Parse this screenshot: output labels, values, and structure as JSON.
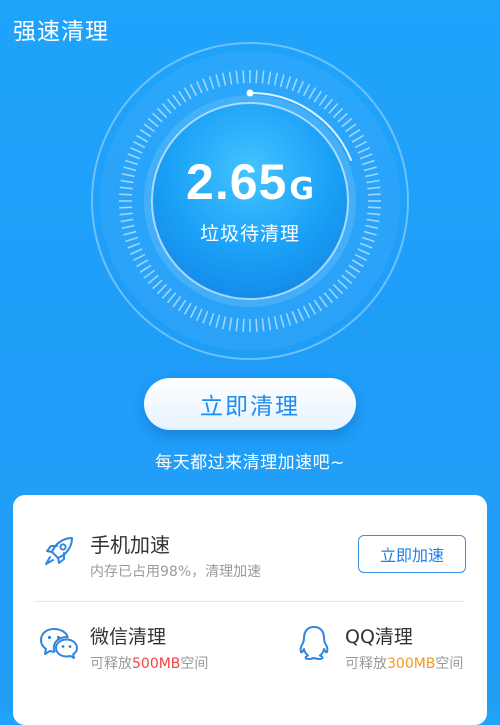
{
  "header": {
    "title": "强速清理"
  },
  "gauge": {
    "value": "2.65",
    "unit": "G",
    "caption": "垃圾待清理"
  },
  "clean_button": {
    "label": "立即清理"
  },
  "tagline": "每天都过来清理加速吧~",
  "phone_speed": {
    "title": "手机加速",
    "subtitle": "内存已占用98%，清理加速",
    "button": "立即加速"
  },
  "wechat_clean": {
    "title": "微信清理",
    "sub_prefix": "可释放",
    "amount": "500MB",
    "sub_suffix": "空间",
    "icon": "wechat-icon",
    "highlight_color": "#f2453d"
  },
  "qq_clean": {
    "title": "QQ清理",
    "sub_prefix": "可释放",
    "amount": "300MB",
    "sub_suffix": "空间",
    "icon": "qq-icon",
    "highlight_color": "#f39a1c"
  },
  "colors": {
    "background": "#1fa3fb",
    "accent": "#1f7fe2"
  }
}
